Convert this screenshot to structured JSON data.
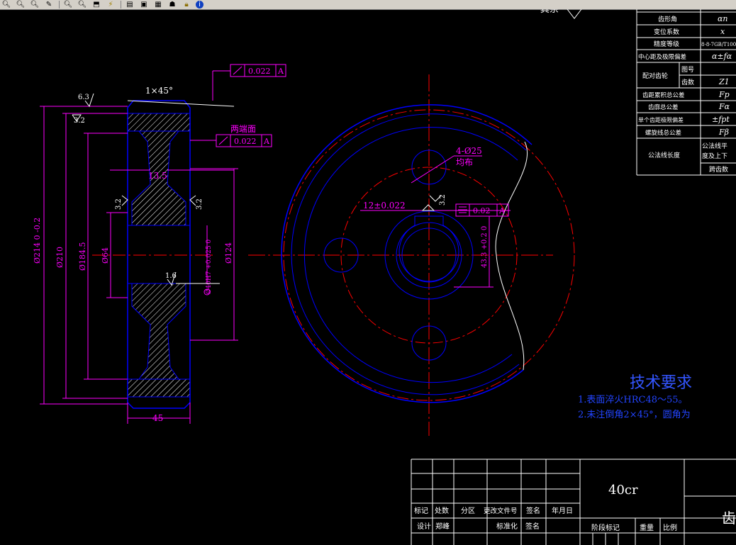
{
  "toolbar": {
    "icons": [
      "zoom-out-icon",
      "zoom-icon",
      "zoom-window-icon",
      "zoom-realtime-icon",
      "zoom-in-icon",
      "zoom-previous-icon",
      "zoom-extents-icon",
      "lightning-icon",
      "layer-icon",
      "properties-icon",
      "design-center-icon",
      "tool-palette-icon",
      "lock-icon",
      "help-icon"
    ],
    "help": "i"
  },
  "colors": {
    "magenta": "#ff00ff",
    "blue": "#0000ff",
    "red": "#ff0000",
    "white": "#ffffff",
    "yellow": "#ffff00",
    "accent_blue": "#3355ff"
  },
  "side_view": {
    "chamfer": "1×45°",
    "roughness_top": "6.3",
    "roughness_top2": "3.2",
    "roughness_left": "3.2",
    "roughness_right": "3.2",
    "roughness_bore": "1.6",
    "web_thickness": "13.5",
    "width": "45",
    "dim_outer": "Ø214 0 -0.2",
    "dim_210": "Ø210",
    "dim_184": "Ø184.5",
    "dim_bore": "Ø64",
    "dim_hub": "Ø124",
    "dim_shaft": "Ø40H7 +0.025 0",
    "tol_top": "0.022",
    "tol_top_ref": "A",
    "tol_mid_label": "两端面",
    "tol_mid": "0.022",
    "tol_mid_ref": "A",
    "datum": "A"
  },
  "front_view": {
    "holes_note1": "4-Ø25",
    "holes_note2": "均布",
    "keyway": "12±0.022",
    "sym_tol": "0.02",
    "sym_ref": "A",
    "keyway_depth": "43.3 +0.2 0",
    "roughness": "3.2"
  },
  "spec_table": {
    "top_label": "其余",
    "rows": [
      {
        "label": "齿形角",
        "symbol": "αn"
      },
      {
        "label": "变位系数",
        "symbol": "x"
      },
      {
        "label": "精度等级",
        "symbol": "8-8-7GB/T100"
      },
      {
        "label": "中心距及极限偏差",
        "symbol": "α±fα"
      },
      {
        "label": "配对齿轮 图号",
        "symbol": ""
      },
      {
        "label": "齿数",
        "symbol": "Z1"
      },
      {
        "label": "齿距累积总公差",
        "symbol": "Fp"
      },
      {
        "label": "齿廓总公差",
        "symbol": "Fα"
      },
      {
        "label": "单个齿距极限偏差",
        "symbol": "±fpt"
      },
      {
        "label": "螺旋线总公差",
        "symbol": "Fβ"
      },
      {
        "label": "公法线长度",
        "symbol": "公法线平均长度及上下偏差"
      },
      {
        "label": "",
        "symbol": "跨齿数"
      }
    ],
    "group_label": "配对齿轮",
    "sub_tuhao": "图号",
    "sub_chishu": "齿数",
    "gongfa_a": "公法线平",
    "gongfa_b": "度及上下"
  },
  "tech_req": {
    "title": "技术要求",
    "line1": "1.表面淬火HRC48～55。",
    "line2": "2.未注倒角2×45°，圆角为"
  },
  "title_block": {
    "material": "40cr",
    "part_name": "齿",
    "row1": [
      "标记",
      "处数",
      "分区",
      "更改文件号",
      "签名",
      "年月日"
    ],
    "row2": [
      "设计",
      "郑峰",
      "",
      "标准化",
      "签名",
      ""
    ],
    "stage": "阶段标记",
    "weight": "重量",
    "scale": "比例"
  }
}
